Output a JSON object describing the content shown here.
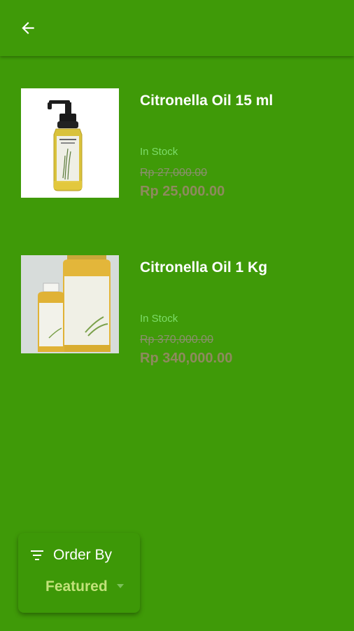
{
  "header": {
    "back_icon": "arrow-left-icon"
  },
  "products": [
    {
      "name": "Citronella Oil 15 ml",
      "stock": "In Stock",
      "old_price": "Rp 27,000.00",
      "price": "Rp 25,000.00"
    },
    {
      "name": "Citronella Oil 1 Kg",
      "stock": "In Stock",
      "old_price": "Rp 370,000.00",
      "price": "Rp 340,000.00"
    }
  ],
  "sort": {
    "icon": "filter-list-icon",
    "label": "Order By",
    "value": "Featured",
    "dropdown_icon": "triangle-down-icon"
  },
  "colors": {
    "background": "#3f9a08",
    "stock": "#7ddc69",
    "price": "#8e8a5e",
    "sort_value": "#c2e27a"
  }
}
